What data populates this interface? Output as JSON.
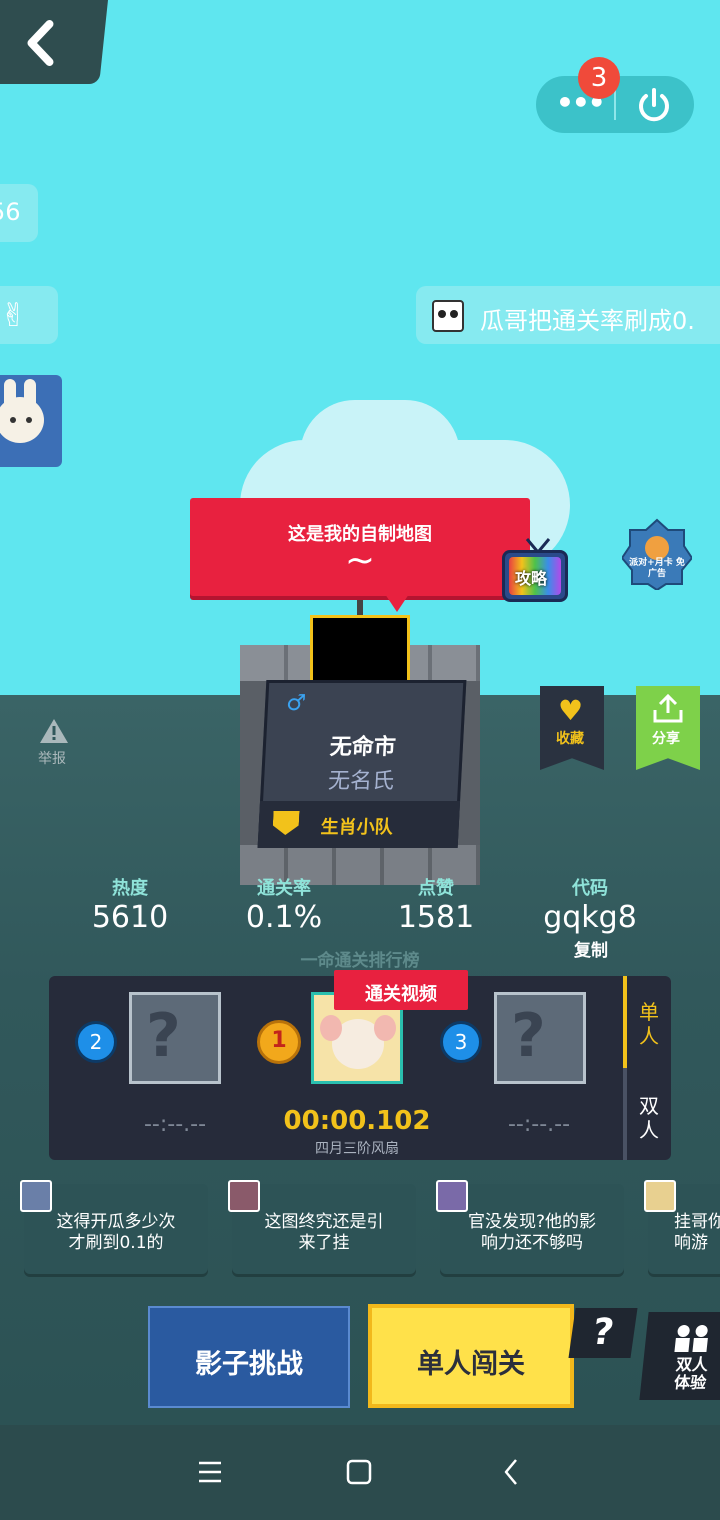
{
  "top": {
    "back_icon": "chevron-left-icon",
    "menu_badge": "3",
    "more_icon": "ellipsis-icon",
    "power_icon": "power-icon"
  },
  "left_chips": {
    "chip1_text": "56",
    "chip2_icon": "peace-hand-icon"
  },
  "ticker": {
    "text": "瓜哥把通关率刷成0."
  },
  "map": {
    "caption": "这是我的自制地图",
    "tilde": "~",
    "guide_label": "攻略",
    "promo_text": "派对+月卡 免广告"
  },
  "author": {
    "gender_icon": "male-icon",
    "name": "无命市",
    "subtitle": "无名氏",
    "team": "生肖小队"
  },
  "actions": {
    "report": "举报",
    "favorite": "收藏",
    "share": "分享"
  },
  "stats": [
    {
      "label": "热度",
      "value": "5610"
    },
    {
      "label": "通关率",
      "value": "0.1%"
    },
    {
      "label": "点赞",
      "value": "1581"
    },
    {
      "label": "代码",
      "value": "gqkg8"
    }
  ],
  "copy_label": "复制",
  "leaderboard": {
    "title": "一命通关排行榜",
    "video_label": "通关视频",
    "rank1": "1",
    "rank2": "2",
    "rank3": "3",
    "time_left": "--:--.--",
    "time_center": "00:00.102",
    "time_right": "--:--.--",
    "winner": "四月三阶风扇",
    "tab_single": "单\n人",
    "tab_double": "双\n人"
  },
  "comments": [
    {
      "text": "这得开瓜多少次\n才刷到0.1的"
    },
    {
      "text": "这图终究还是引\n来了挂"
    },
    {
      "text": "官没发现?他的影\n响力还不够吗"
    },
    {
      "text": "挂哥你\n响游"
    }
  ],
  "buttons": {
    "shadow": "影子挑战",
    "single": "单人闯关",
    "help": "?",
    "duo": "双人\n体验"
  },
  "colors": {
    "sky": "#5fe6ef",
    "banner_red": "#e8213f",
    "gold": "#f2c21b",
    "green": "#7ed14a",
    "blue_button": "#2a5aa0",
    "yellow_button": "#ffe14a"
  }
}
